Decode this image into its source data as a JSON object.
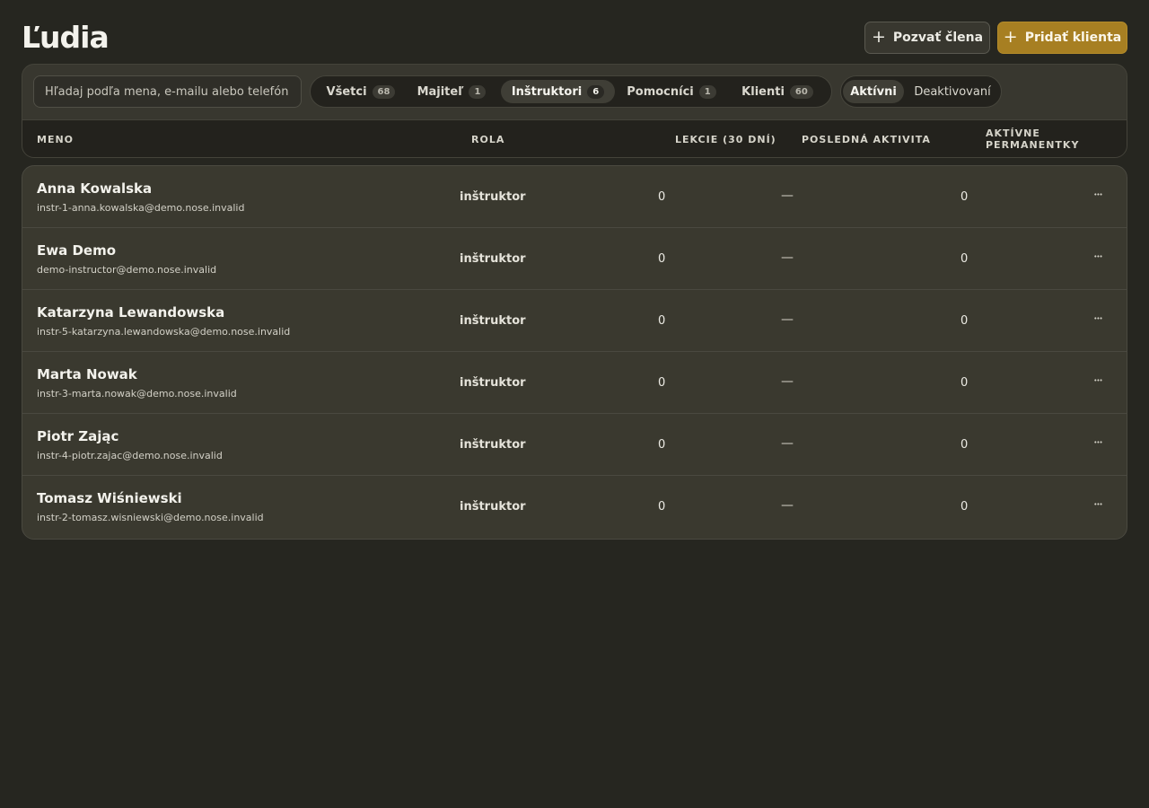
{
  "page": {
    "title": "Ľudia",
    "invite_button": "Pozvať člena",
    "add_client_button": "Pridať klienta"
  },
  "search": {
    "placeholder": "Hľadaj podľa mena, e-mailu alebo telefón"
  },
  "role_filters": [
    {
      "label": "Všetci",
      "count": "68"
    },
    {
      "label": "Majiteľ",
      "count": "1"
    },
    {
      "label": "Inštruktori",
      "count": "6"
    },
    {
      "label": "Pomocníci",
      "count": "1"
    },
    {
      "label": "Klienti",
      "count": "60"
    }
  ],
  "role_filter_active": "Inštruktori",
  "status_filters": [
    {
      "label": "Aktívni"
    },
    {
      "label": "Deaktivovaní"
    }
  ],
  "status_filter_active": "Aktívni",
  "table": {
    "headers": {
      "name": "MENO",
      "role": "ROLA",
      "lessons": "LEKCIE (30 DNÍ)",
      "activity": "POSLEDNÁ AKTIVITA",
      "passes": "AKTÍVNE PERMANENTKY"
    },
    "rows": [
      {
        "name": "Anna Kowalska",
        "email": "instr-1-anna.kowalska@demo.nose.invalid",
        "role": "inštruktor",
        "lessons": "0",
        "activity": "—",
        "passes": "0"
      },
      {
        "name": "Ewa Demo",
        "email": "demo-instructor@demo.nose.invalid",
        "role": "inštruktor",
        "lessons": "0",
        "activity": "—",
        "passes": "0"
      },
      {
        "name": "Katarzyna Lewandowska",
        "email": "instr-5-katarzyna.lewandowska@demo.nose.invalid",
        "role": "inštruktor",
        "lessons": "0",
        "activity": "—",
        "passes": "0"
      },
      {
        "name": "Marta Nowak",
        "email": "instr-3-marta.nowak@demo.nose.invalid",
        "role": "inštruktor",
        "lessons": "0",
        "activity": "—",
        "passes": "0"
      },
      {
        "name": "Piotr Zając",
        "email": "instr-4-piotr.zajac@demo.nose.invalid",
        "role": "inštruktor",
        "lessons": "0",
        "activity": "—",
        "passes": "0"
      },
      {
        "name": "Tomasz Wiśniewski",
        "email": "instr-2-tomasz.wisniewski@demo.nose.invalid",
        "role": "inštruktor",
        "lessons": "0",
        "activity": "—",
        "passes": "0"
      }
    ]
  },
  "colors": {
    "background": "#262620",
    "panel": "#38372f",
    "accent": "#a77f22"
  },
  "icons": {
    "add": "plus-icon",
    "row_menu": "more-horizontal-icon"
  }
}
